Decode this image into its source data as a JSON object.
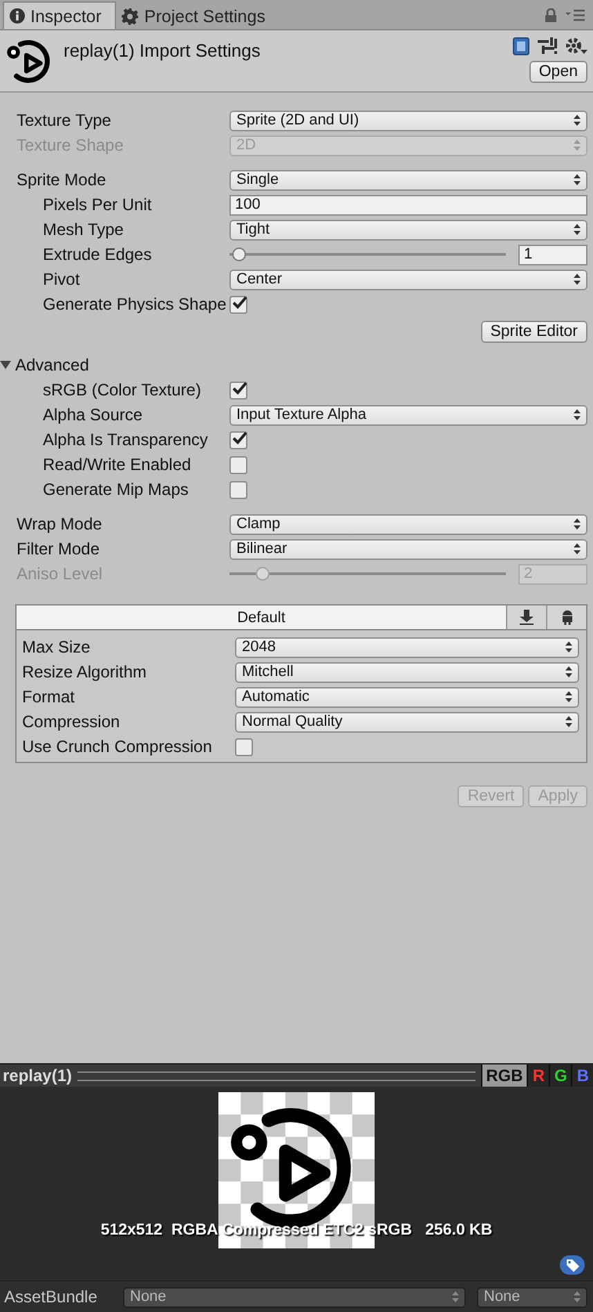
{
  "tabs": [
    {
      "label": "Inspector",
      "selected": true
    },
    {
      "label": "Project Settings",
      "selected": false
    }
  ],
  "header": {
    "title": "replay(1) Import Settings",
    "open_button": "Open"
  },
  "groups": [
    [
      {
        "kind": "dropdown",
        "label": "Texture Type",
        "value": "Sprite (2D and UI)",
        "disabled": false
      },
      {
        "kind": "dropdown",
        "label": "Texture Shape",
        "value": "2D",
        "disabled": true
      }
    ],
    [
      {
        "kind": "dropdown",
        "label": "Sprite Mode",
        "value": "Single",
        "disabled": false,
        "children": [
          {
            "kind": "text",
            "label": "Pixels Per Unit",
            "value": "100",
            "disabled": false
          },
          {
            "kind": "dropdown",
            "label": "Mesh Type",
            "value": "Tight",
            "disabled": false
          },
          {
            "kind": "slider",
            "label": "Extrude Edges",
            "level": 0.01,
            "value": "1",
            "disabled": false
          },
          {
            "kind": "dropdown",
            "label": "Pivot",
            "value": "Center",
            "disabled": false
          },
          {
            "kind": "checkbox",
            "label": "Generate Physics Shape",
            "checked": true
          }
        ]
      },
      {
        "kind": "button",
        "label": "Sprite Editor",
        "disabled": false
      }
    ],
    [
      {
        "kind": "foldout",
        "label": "Advanced",
        "expanded": true,
        "children": [
          {
            "kind": "checkbox",
            "label": "sRGB (Color Texture)",
            "checked": true
          },
          {
            "kind": "dropdown",
            "label": "Alpha Source",
            "value": "Input Texture Alpha",
            "disabled": false
          },
          {
            "kind": "checkbox",
            "label": "Alpha Is Transparency",
            "checked": true
          },
          {
            "kind": "checkbox",
            "label": "Read/Write Enabled",
            "checked": false
          },
          {
            "kind": "checkbox",
            "label": "Generate Mip Maps",
            "checked": false
          }
        ]
      }
    ],
    [
      {
        "kind": "dropdown",
        "label": "Wrap Mode",
        "value": "Clamp",
        "disabled": false
      },
      {
        "kind": "dropdown",
        "label": "Filter Mode",
        "value": "Bilinear",
        "disabled": false
      },
      {
        "kind": "slider",
        "label": "Aniso Level",
        "level": 0.1,
        "value": "2",
        "disabled": true
      }
    ]
  ],
  "platform": {
    "tabs": [
      {
        "label": "Default",
        "selected": true
      },
      {
        "selected": false
      },
      {
        "selected": false
      }
    ],
    "rows": [
      {
        "kind": "dropdown",
        "label": "Max Size",
        "value": "2048",
        "disabled": false
      },
      {
        "kind": "dropdown",
        "label": "Resize Algorithm",
        "value": "Mitchell",
        "disabled": false
      },
      {
        "kind": "dropdown",
        "label": "Format",
        "value": "Automatic",
        "disabled": false
      },
      {
        "kind": "dropdown",
        "label": "Compression",
        "value": "Normal Quality",
        "disabled": false
      },
      {
        "kind": "checkbox",
        "label": "Use Crunch Compression",
        "checked": false
      }
    ]
  },
  "footer_buttons": [
    {
      "label": "Revert",
      "disabled": true
    },
    {
      "label": "Apply",
      "disabled": true
    }
  ],
  "preview": {
    "title": "replay(1)",
    "channels": [
      {
        "label": "RGB",
        "selected": true,
        "color": "#111111"
      },
      {
        "label": "R",
        "selected": false,
        "color": "#ff3030"
      },
      {
        "label": "G",
        "selected": false,
        "color": "#30d030"
      },
      {
        "label": "B",
        "selected": false,
        "color": "#6070ff"
      }
    ],
    "info": "512x512  RGBA Compressed ETC2 sRGB   256.0 KB"
  },
  "asset_bundle": {
    "label": "AssetBundle",
    "values": [
      "None",
      "None"
    ]
  }
}
